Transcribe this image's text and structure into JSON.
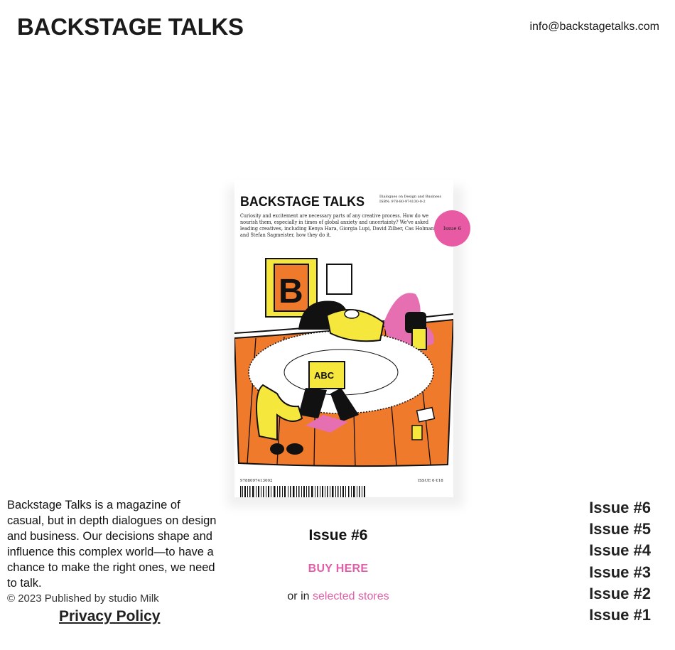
{
  "header": {
    "logo": "BACKSTAGE TALKS",
    "email": "info@backstagetalks.com"
  },
  "cover": {
    "title": "BACKSTAGE TALKS",
    "tagline_line1": "Dialogues on Design and Business",
    "tagline_line2": "ISBN: 978-80-974130-0-2",
    "blurb_lines": [
      "Curiosity and excitement are necessary parts of any creative process. How do we",
      "nourish them, especially in times of global anxiety and uncertainty? We've asked",
      "leading creatives, including Kenya Hara, Giorgia Lupi, David Zilber, Cas Holman",
      "and Stefan Sagmeister, how they do it."
    ],
    "badge": "Issue 6",
    "poster_letter": "B",
    "tshirt_text": "ABC",
    "barcode_number": "9788097413002",
    "issue_price": "ISSUE 6  €18",
    "colors": {
      "badge": "#e95aa5",
      "floor": "#f07a2b",
      "poster": "#f6e73d",
      "accent_pink": "#e56fb0"
    }
  },
  "about": {
    "text": "Backstage Talks is a magazine of casual, but in depth dialogues on design and business. Our decisions shape and influence this complex world—to have a chance to make the right ones, we need to talk.",
    "copyright": "© 2023 Published by studio Milk",
    "privacy": "Privacy Policy"
  },
  "current_issue": {
    "title": "Issue #6",
    "buy_label": "BUY HERE",
    "stores_prefix": "or in ",
    "stores_link": "selected stores"
  },
  "issues": [
    {
      "label": "Issue #6"
    },
    {
      "label": "Issue #5"
    },
    {
      "label": "Issue #4"
    },
    {
      "label": "Issue #3"
    },
    {
      "label": "Issue #2"
    },
    {
      "label": "Issue #1"
    }
  ],
  "colors": {
    "accent": "#e05fa8",
    "text": "#111111",
    "background": "#ffffff"
  }
}
